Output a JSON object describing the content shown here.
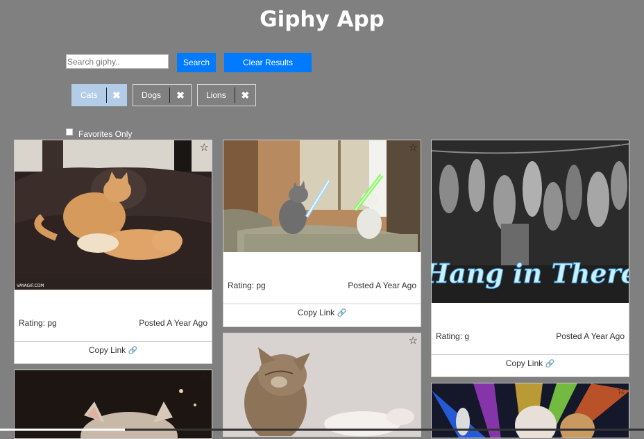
{
  "header": {
    "title": "Giphy App"
  },
  "search": {
    "placeholder": "Search giphy..",
    "button_label": "Search",
    "clear_label": "Clear Results"
  },
  "tags": [
    {
      "label": "Cats",
      "active": true
    },
    {
      "label": "Dogs",
      "active": false
    },
    {
      "label": "Lions",
      "active": false
    }
  ],
  "tag_close_glyph": "✖",
  "filter": {
    "favorites_label": "Favorites Only",
    "checked": false
  },
  "star_glyph": "☆",
  "link_glyph": "🔗",
  "cards": [
    {
      "rating": "Rating: pg",
      "posted": "Posted A Year Ago",
      "copy": "Copy Link",
      "watermark": "VAYAGIF.COM"
    },
    {
      "rating": "Rating: pg",
      "posted": "Posted A Year Ago",
      "copy": "Copy Link"
    },
    {
      "rating": "Rating: g",
      "posted": "Posted A Year Ago",
      "copy": "Copy Link",
      "caption": "Hang in There"
    }
  ],
  "colors": {
    "background": "#808080",
    "accent": "#007bff",
    "active_tag": "#b3cde8"
  }
}
